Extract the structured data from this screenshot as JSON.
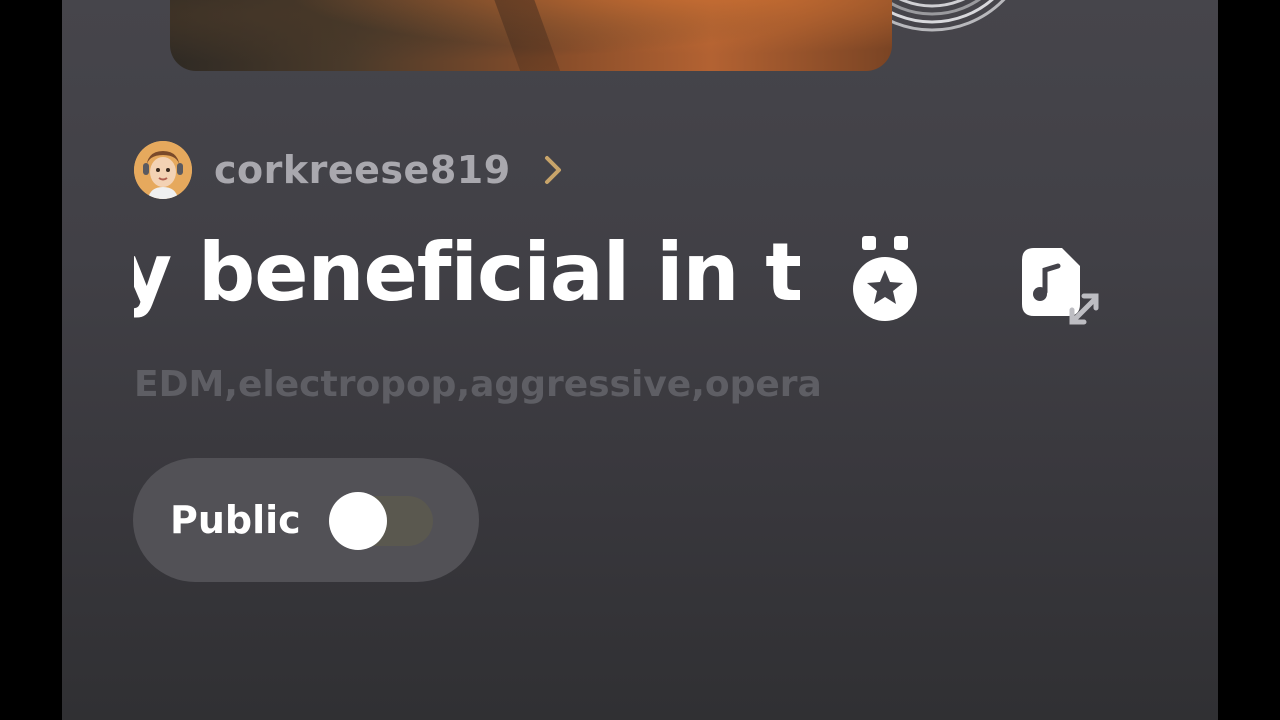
{
  "creator": {
    "username": "corkreese819",
    "avatar_icon": "avatar-face-icon"
  },
  "song": {
    "title": "y beneficial in t",
    "tags": "EDM,electropop,aggressive,opera"
  },
  "actions": {
    "medal_icon": "medal-star-icon",
    "music_file_icon": "music-file-resize-icon"
  },
  "visibility": {
    "label": "Public",
    "enabled": false
  },
  "colors": {
    "panel_bg": "#424147",
    "username": "#a9a8ae",
    "chevron": "#c8a46a",
    "tags": "#5e5e64",
    "pill_bg": "#525156"
  }
}
